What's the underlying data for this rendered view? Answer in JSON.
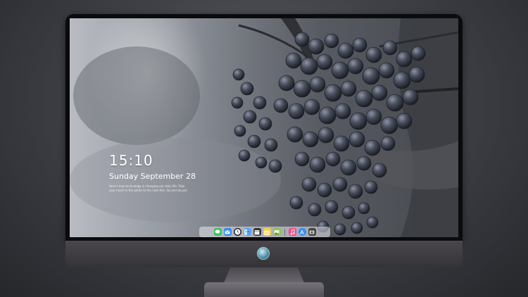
{
  "lock_screen": {
    "time": "15:10",
    "date": "Sunday September 28",
    "caption_line_1": "Here's how technology is changing our daily life. Take",
    "caption_line_2": "your heart to the photo to the next film. Go and do just"
  },
  "dock": {
    "apps": [
      {
        "name": "messages-icon",
        "color": "#3fc25a"
      },
      {
        "name": "mail-icon",
        "color": "#2f8cf5"
      },
      {
        "name": "clock-icon",
        "color": "#222222"
      },
      {
        "name": "finder-icon",
        "color": "#5aa3f0"
      },
      {
        "name": "clapper-icon",
        "color": "#333333"
      },
      {
        "name": "notes-icon",
        "color": "#f6d24a"
      },
      {
        "name": "photos-icon",
        "color": "#8bc34a"
      },
      {
        "name": "music-icon",
        "color": "#f0508a"
      },
      {
        "name": "appstore-icon",
        "color": "#2e8ff2"
      },
      {
        "name": "camera-icon",
        "color": "#444444"
      }
    ]
  }
}
